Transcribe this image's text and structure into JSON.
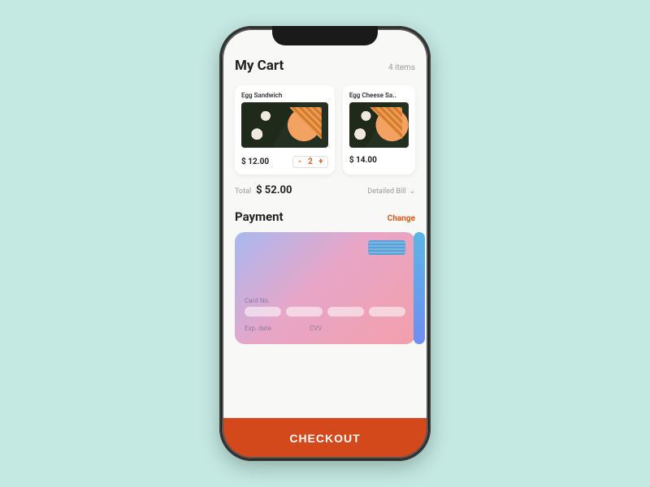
{
  "header": {
    "title": "My Cart",
    "items_count": "4 items"
  },
  "cart_items": [
    {
      "name": "Egg Sandwich",
      "price": "$ 12.00",
      "qty": "2"
    },
    {
      "name": "Egg Cheese Sa..",
      "price": "$ 14.00",
      "qty": ""
    }
  ],
  "total": {
    "label": "Total",
    "value": "$ 52.00",
    "detailed": "Detailed Bill"
  },
  "payment": {
    "section_title": "Payment",
    "change_label": "Change",
    "card_no_label": "Card No.",
    "exp_label": "Exp. date",
    "cvv_label": "CVV"
  },
  "checkout_label": "CHECKOUT",
  "colors": {
    "accent": "#d85a1a",
    "checkout_bg": "#d4491b"
  }
}
